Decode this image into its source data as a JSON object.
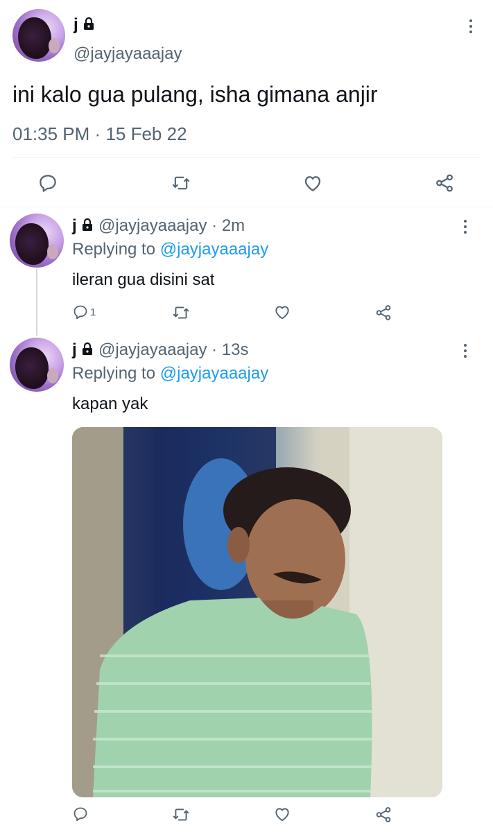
{
  "main_tweet": {
    "display_name": "j",
    "handle": "@jayjayaaajay",
    "text": "ini kalo gua pulang, isha gimana anjir",
    "time": "01:35 PM",
    "separator": "·",
    "date": "15 Feb 22",
    "actions": [
      "reply-icon",
      "retweet-icon",
      "like-icon",
      "share-icon"
    ]
  },
  "replies": [
    {
      "display_name": "j",
      "handle": "@jayjayaaajay",
      "separator": "·",
      "time": "2m",
      "replying_label": "Replying to",
      "replying_to": "@jayjayaaajay",
      "text": "ileran gua disini sat",
      "reply_count": "1"
    },
    {
      "display_name": "j",
      "handle": "@jayjayaaajay",
      "separator": "·",
      "time": "13s",
      "replying_label": "Replying to",
      "replying_to": "@jayjayaaajay",
      "text": "kapan yak",
      "media": "photo of a sad man in a mint striped shirt leaning against a wall"
    }
  ],
  "colors": {
    "text": "#0f1419",
    "muted": "#536471",
    "link": "#1d9bf0",
    "divider": "#eff3f4"
  }
}
